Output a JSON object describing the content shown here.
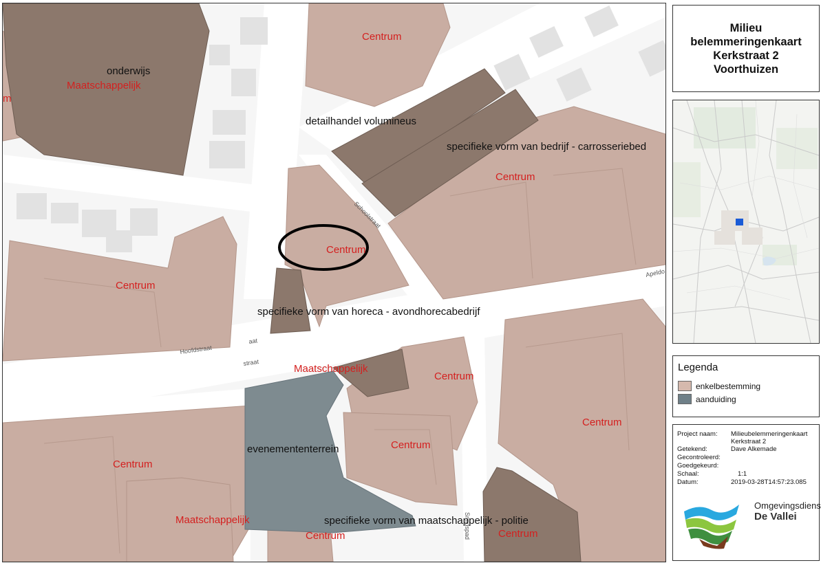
{
  "title": {
    "lines": [
      "Milieu",
      "belemmeringenkaart",
      "Kerkstraat 2",
      "Voorthuizen"
    ]
  },
  "map": {
    "labels": {
      "centrum_top": "Centrum",
      "onderwijs": "onderwijs",
      "maatschappelijk_top": "Maatschappelijk",
      "centrum_left_edge": "m",
      "detailhandel": "detailhandel volumineus",
      "carrosserie": "specifieke vorm van bedrijf - carrosseriebed",
      "centrum_right_mid": "Centrum",
      "centrum_circle": "Centrum",
      "centrum_left": "Centrum",
      "horeca": "specifieke vorm van horeca - avondhorecabedrijf",
      "maatschappelijk_mid": "Maatschappelijk",
      "centrum_mid_right": "Centrum",
      "centrum_far_right": "Centrum",
      "evenemententerrein": "evenemententerrein",
      "centrum_inner": "Centrum",
      "centrum_bottom_left": "Centrum",
      "maatschappelijk_bottom": "Maatschappelijk",
      "politie": "specifieke vorm van maatschappelijk - politie",
      "centrum_bottom": "Centrum",
      "centrum_bottom_right": "Centrum"
    },
    "streets": {
      "schoolstraat": "Schoolstraat",
      "apeldoorn": "Apeldo",
      "hoofdstraat": "Hoofdstraat",
      "aat": "aat",
      "straat": "straat",
      "smidspad": "Smidspad"
    },
    "colors": {
      "enkelbestemming": "#c9ada2",
      "aanduiding_dark": "#8c786c",
      "evenemententerrein": "#7e8b90",
      "building": "#e2e2e2",
      "road": "#ffffff",
      "circle": "#000000"
    }
  },
  "legend": {
    "title": "Legenda",
    "items": [
      {
        "label": "enkelbestemming",
        "color": "#d5b9ad"
      },
      {
        "label": "aanduiding",
        "color": "#6f8088"
      }
    ]
  },
  "info": {
    "project_key": "Project naam:",
    "project_value": "Milieubelemmeringenkaart",
    "project_value2": "Kerkstraat 2",
    "getekend_key": "Getekend:",
    "getekend_value": "Dave Alkemade",
    "gecontroleerd_key": "Gecontroleerd:",
    "goedgekeurd_key": "Goedgekeurd:",
    "schaal_key": "Schaal:",
    "schaal_value": "1:1",
    "datum_key": "Datum:",
    "datum_value": "2019-03-28T14:57:23.085"
  },
  "logo": {
    "line1": "Omgevingsdienst",
    "line2": "De Vallei",
    "icon": "omgevingsdienst-logo-icon"
  },
  "overview": {
    "marker_color": "#1a5bd6",
    "icon": "overview-map"
  }
}
